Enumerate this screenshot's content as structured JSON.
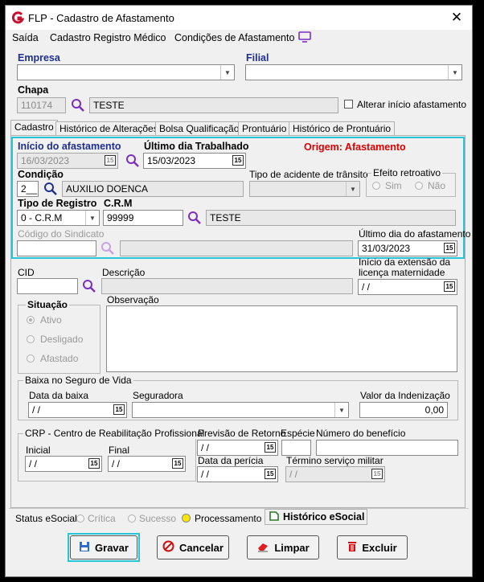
{
  "window": {
    "title": "FLP - Cadastro de Afastamento"
  },
  "menu": {
    "items": [
      "Saída",
      "Cadastro Registro Médico",
      "Condições de Afastamento"
    ]
  },
  "top": {
    "empresa_label": "Empresa",
    "filial_label": "Filial",
    "chapa_label": "Chapa",
    "chapa_value": "110174",
    "chapa_name": "TESTE",
    "alterar_label": "Alterar início afastamento"
  },
  "tabs": [
    "Cadastro",
    "Histórico de Alterações",
    "Bolsa Qualificação",
    "Prontuário",
    "Histórico de Prontuário"
  ],
  "afastamento": {
    "inicio_label": "Início do afastamento",
    "inicio_value": "16/03/2023",
    "ultimo_trab_label": "Último dia Trabalhado",
    "ultimo_trab_value": "15/03/2023",
    "origem_label": "Origem: Afastamento",
    "condicao_label": "Condição",
    "condicao_code": "2__",
    "condicao_desc": "AUXILIO DOENCA",
    "tipo_acidente_label": "Tipo de acidente de trânsito",
    "efeito_label": "Efeito retroativo",
    "efeito_sim": "Sim",
    "efeito_nao": "Não",
    "tipo_registro_label": "Tipo de Registro",
    "tipo_registro_value": "0 - C.R.M",
    "crm_label": "C.R.M",
    "crm_value": "99999",
    "crm_name": "TESTE",
    "sindicato_label": "Código do Sindicato",
    "ultimo_afast_label": "Último dia do afastamento",
    "ultimo_afast_value": "31/03/2023"
  },
  "detalhes": {
    "cid_label": "CID",
    "descricao_label": "Descrição",
    "extensao_label_1": "Início da extensão da",
    "extensao_label_2": "licença maternidade",
    "extensao_value": " / /",
    "situacao_label": "Situação",
    "situacao_ativo": "Ativo",
    "situacao_desligado": "Desligado",
    "situacao_afastado": "Afastado",
    "observacao_label": "Observação"
  },
  "seguro": {
    "group_label": "Baixa no Seguro de Vida",
    "data_baixa_label": "Data da baixa",
    "data_baixa_value": " / /",
    "seguradora_label": "Seguradora",
    "valor_label": "Valor da Indenização",
    "valor_value": "0,00"
  },
  "crp": {
    "group_label": "CRP - Centro de Reabilitação Profissional",
    "inicial_label": "Inicial",
    "inicial_value": " / /",
    "final_label": "Final",
    "final_value": " / /",
    "previsao_label": "Previsão de Retorno",
    "previsao_value": " / /",
    "especie_label": "Espécie",
    "beneficio_label": "Número do benefício",
    "pericia_label": "Data da perícia",
    "pericia_value": " / /",
    "termino_label": "Término serviço militar",
    "termino_value": " / /"
  },
  "status": {
    "label": "Status eSocial:",
    "critica": "Crítica",
    "sucesso": "Sucesso",
    "processamento": "Processamento",
    "historico": "Histórico eSocial"
  },
  "buttons": {
    "gravar": "Gravar",
    "cancelar": "Cancelar",
    "limpar": "Limpar",
    "excluir": "Excluir"
  },
  "colors": {
    "highlight": "#27c5d8",
    "blue_label": "#1f2f8f",
    "origem_red": "#e00000",
    "search_purple": "#7b2fbf"
  }
}
